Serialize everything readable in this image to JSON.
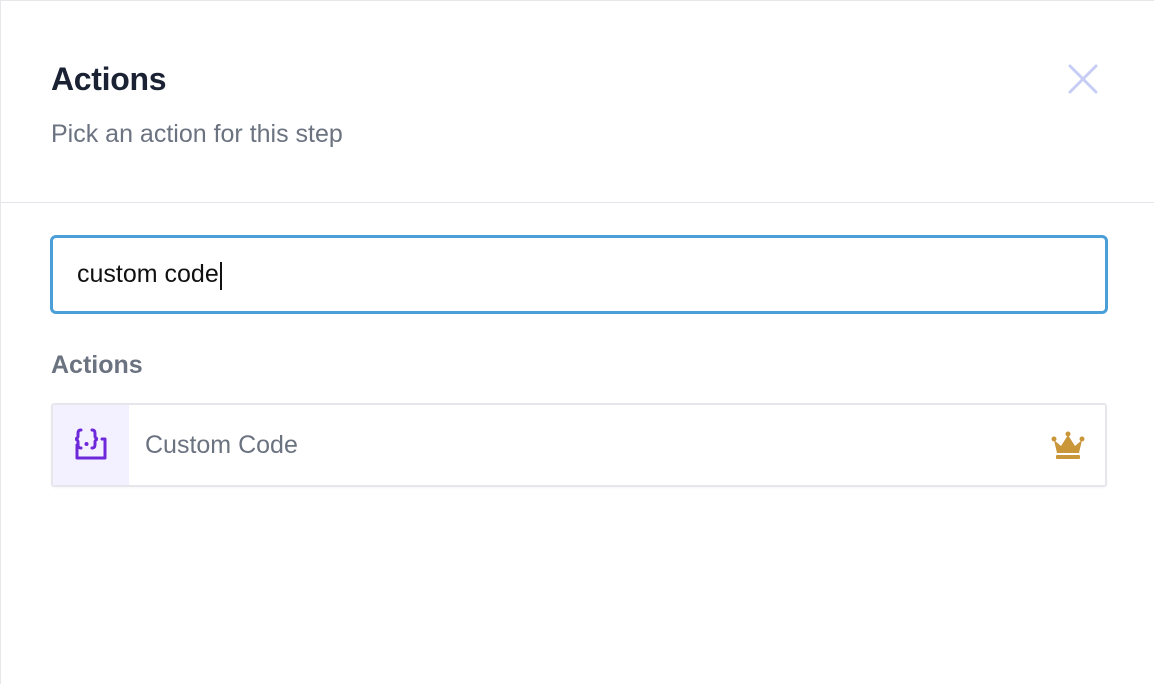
{
  "header": {
    "title": "Actions",
    "subtitle": "Pick an action for this step",
    "close_icon": "close-icon"
  },
  "search": {
    "value": "custom code",
    "placeholder": ""
  },
  "results": {
    "section_label": "Actions",
    "items": [
      {
        "label": "Custom Code",
        "icon": "code-braces-icon",
        "badge_icon": "crown-icon",
        "icon_color": "#6d28d9",
        "icon_bg": "#f3f0ff",
        "badge_color": "#c9973a"
      }
    ]
  },
  "colors": {
    "focus_border": "#4a9fd8",
    "close_icon": "#c7cdf5",
    "title": "#1a2233",
    "muted_text": "#6b7280"
  }
}
